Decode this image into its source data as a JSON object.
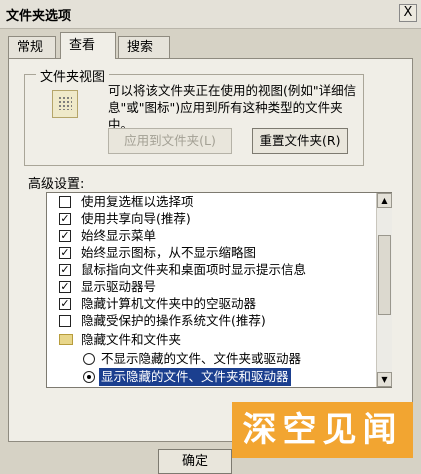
{
  "window": {
    "title": "文件夹选项",
    "close_label": "X"
  },
  "tabs": [
    {
      "label": "常规"
    },
    {
      "label": "查看"
    },
    {
      "label": "搜索"
    }
  ],
  "folder_views": {
    "legend": "文件夹视图",
    "description": "可以将该文件夹正在使用的视图(例如\"详细信息\"或\"图标\")应用到所有这种类型的文件夹中。",
    "apply_button": "应用到文件夹(L)",
    "reset_button": "重置文件夹(R)"
  },
  "advanced": {
    "label": "高级设置:",
    "items": [
      {
        "type": "checkbox",
        "checked": false,
        "label": "使用复选框以选择项"
      },
      {
        "type": "checkbox",
        "checked": true,
        "label": "使用共享向导(推荐)"
      },
      {
        "type": "checkbox",
        "checked": true,
        "label": "始终显示菜单"
      },
      {
        "type": "checkbox",
        "checked": true,
        "label": "始终显示图标，从不显示缩略图"
      },
      {
        "type": "checkbox",
        "checked": true,
        "label": "鼠标指向文件夹和桌面项时显示提示信息"
      },
      {
        "type": "checkbox",
        "checked": true,
        "label": "显示驱动器号"
      },
      {
        "type": "checkbox",
        "checked": true,
        "label": "隐藏计算机文件夹中的空驱动器"
      },
      {
        "type": "checkbox",
        "checked": false,
        "label": "隐藏受保护的操作系统文件(推荐)"
      },
      {
        "type": "folder",
        "label": "隐藏文件和文件夹"
      },
      {
        "type": "radio",
        "checked": false,
        "label": "不显示隐藏的文件、文件夹或驱动器"
      },
      {
        "type": "radio",
        "checked": true,
        "label": "显示隐藏的文件、文件夹和驱动器"
      }
    ]
  },
  "footer": {
    "ok_button": "确定"
  },
  "watermark": {
    "text": "深空见闻"
  }
}
